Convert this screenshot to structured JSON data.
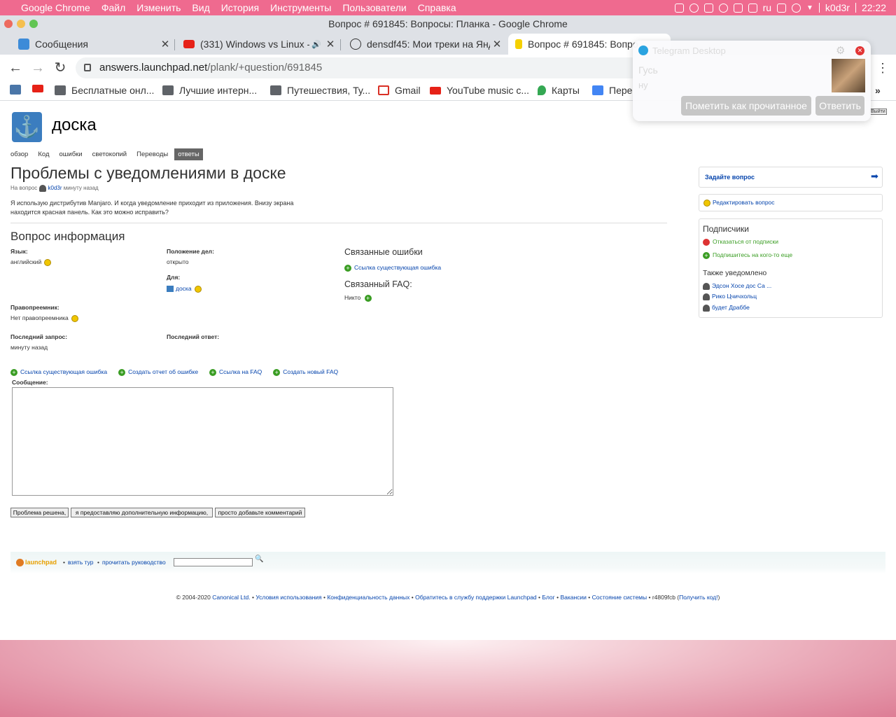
{
  "menubar": {
    "app": "Google Chrome",
    "items": [
      "Файл",
      "Изменить",
      "Вид",
      "История",
      "Инструменты",
      "Пользователи",
      "Справка"
    ],
    "lang": "ru",
    "user": "k0d3r",
    "time": "22:22"
  },
  "window": {
    "title": "Вопрос # 691845: Вопросы: Планка - Google Chrome"
  },
  "tabs": [
    {
      "label": "Сообщения"
    },
    {
      "label": "(331) Windows vs Linux -"
    },
    {
      "label": "densdf45: Мои треки на Янд"
    },
    {
      "label": "Вопрос # 691845: Вопро"
    }
  ],
  "toolbar": {
    "url_host": "answers.launchpad.net",
    "url_path": "/plank/+question/691845"
  },
  "bookmarks": [
    "Бесплатные онл...",
    "Лучшие интерн...",
    "Путешествия, Ту...",
    "Gmail",
    "YouTube music c...",
    "Карты",
    "Пере"
  ],
  "page": {
    "project": "доска",
    "project_tabs": [
      "обзор",
      "Код",
      "ошибки",
      "светокопий",
      "Переводы",
      "ответы"
    ],
    "question_title": "Проблемы с уведомлениями в доске",
    "meta_prefix": "На вопрос",
    "meta_user": "k0d3r",
    "meta_time": "минуту назад",
    "description": "Я использую дистрибутив Manjaro. И когда уведомление приходит из приложения. Внизу экрана находится красная панель. Как это можно исправить?",
    "info_heading": "Вопрос информация",
    "language_label": "Язык:",
    "language_value": "английский",
    "status_label": "Положение дел:",
    "status_value": "открыто",
    "for_label": "Для:",
    "for_value": "доска",
    "assignee_label": "Правопреемник:",
    "assignee_value": "Нет правопреемника",
    "last_query_label": "Последний запрос:",
    "last_query_value": "минуту назад",
    "last_reply_label": "Последний ответ:",
    "related_bugs_heading": "Связанные ошибки",
    "link_existing_bug": "Ссылка существующая ошибка",
    "related_faq_heading": "Связанный FAQ:",
    "faq_value": "Никто",
    "actions": [
      "Ссылка существующая ошибка",
      "Создать отчет об ошибке",
      "Ссылка на FAQ",
      "Создать новый FAQ"
    ],
    "message_label": "Сообщение:",
    "submit_buttons": [
      "Проблема решена,",
      "я предоставляю дополнительную информацию,",
      "просто добавьте комментарий"
    ],
    "logout_fragment": "Выйти"
  },
  "sidebar": {
    "ask": "Задайте вопрос",
    "edit": "Редактировать вопрос",
    "subscribers_heading": "Подписчики",
    "unsubscribe": "Отказаться от подписки",
    "subscribe_other": "Подпишитесь на кого-то еще",
    "also_notified": "Также уведомлено",
    "people": [
      "Эдсон Хосе дос Са ...",
      "Рико Цчичхольц",
      "будет Драббе"
    ]
  },
  "footer": {
    "brand": "launchpad",
    "tour": "взять тур",
    "guide": "прочитать руководство",
    "copyright": "© 2004-2020",
    "links": [
      "Canonical Ltd.",
      "Условия использования",
      "Конфиденциальность данных",
      "Обратитесь в службу поддержки Launchpad",
      "Блог",
      "Вакансии",
      "Состояние системы"
    ],
    "revision": "r4809fcb",
    "get_code": "Получить код!"
  },
  "telegram": {
    "app": "Telegram Desktop",
    "sender": "Гусь",
    "message": "ну",
    "mark_read": "Пометить как прочитанное",
    "reply": "Ответить"
  },
  "colors": {
    "menubar": "#ef6a8f",
    "link": "#0645ad",
    "chrome_tab_bg": "#dee1e6"
  }
}
